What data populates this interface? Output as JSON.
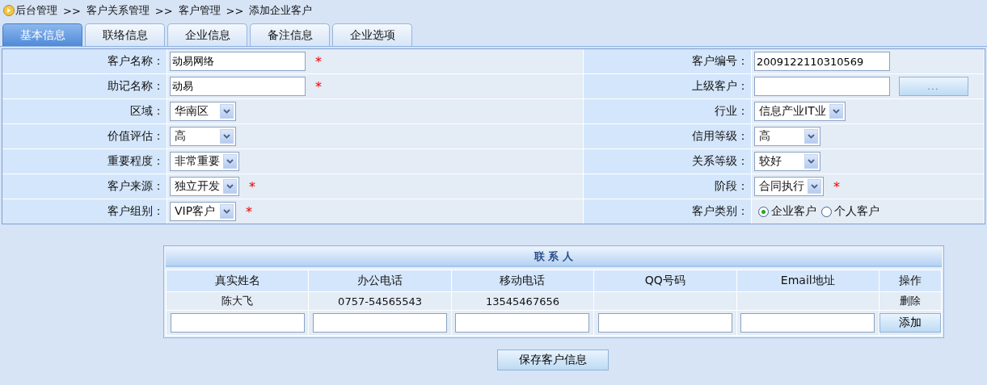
{
  "breadcrumb": [
    {
      "kind": "link",
      "text": "后台管理"
    },
    {
      "kind": "separator",
      "text": ">>"
    },
    {
      "kind": "link",
      "text": "客户关系管理"
    },
    {
      "kind": "separator",
      "text": ">>"
    },
    {
      "kind": "link",
      "text": "客户管理"
    },
    {
      "kind": "separator",
      "text": ">>"
    },
    {
      "kind": "link",
      "text": "添加企业客户"
    }
  ],
  "tabs": [
    {
      "label": "基本信息",
      "selected": true
    },
    {
      "label": "联络信息",
      "selected": false
    },
    {
      "label": "企业信息",
      "selected": false
    },
    {
      "label": "备注信息",
      "selected": false
    },
    {
      "label": "企业选项",
      "selected": false
    }
  ],
  "form_rows": [
    {
      "left": {
        "label": "客户名称：",
        "kind": "text",
        "value": "动易网络",
        "required_mark": "*"
      },
      "right": {
        "label": "客户编号：",
        "kind": "text",
        "value": "2009122110310569"
      }
    },
    {
      "left": {
        "label": "助记名称：",
        "kind": "text",
        "value": "动易",
        "required_mark": "*"
      },
      "right": {
        "label": "上级客户：",
        "kind": "text_button",
        "button": "..."
      }
    },
    {
      "left": {
        "label": "区域：",
        "kind": "select",
        "value": "华南区"
      },
      "right": {
        "label": "行业：",
        "kind": "select",
        "value": "信息产业IT业"
      }
    },
    {
      "left": {
        "label": "价值评估：",
        "kind": "select",
        "value": "高"
      },
      "right": {
        "label": "信用等级：",
        "kind": "select",
        "value": "高"
      }
    },
    {
      "left": {
        "label": "重要程度：",
        "kind": "select",
        "value": "非常重要"
      },
      "right": {
        "label": "关系等级：",
        "kind": "select",
        "value": "较好"
      }
    },
    {
      "left": {
        "label": "客户来源：",
        "kind": "select",
        "value": "独立开发",
        "required_mark": "*"
      },
      "right": {
        "label": "阶段：",
        "kind": "select",
        "value": "合同执行",
        "required_mark": "*"
      }
    },
    {
      "left": {
        "label": "客户组别：",
        "kind": "select",
        "value": "VIP客户",
        "required_mark": "*"
      },
      "right": {
        "label": "客户类别：",
        "kind": "radio",
        "options": [
          {
            "label": "企业客户",
            "selected": true
          },
          {
            "label": "个人客户",
            "selected": false
          }
        ]
      }
    }
  ],
  "contacts": {
    "title": "联 系 人",
    "columns": [
      "真实姓名",
      "办公电话",
      "移动电话",
      "QQ号码",
      "Email地址",
      "操作"
    ],
    "rows": [
      {
        "name": "陈大飞",
        "office_phone": "0757-54565543",
        "mobile": "13545467656",
        "action": "删除"
      }
    ],
    "add_button": "添加"
  },
  "save_button": "保存客户信息"
}
